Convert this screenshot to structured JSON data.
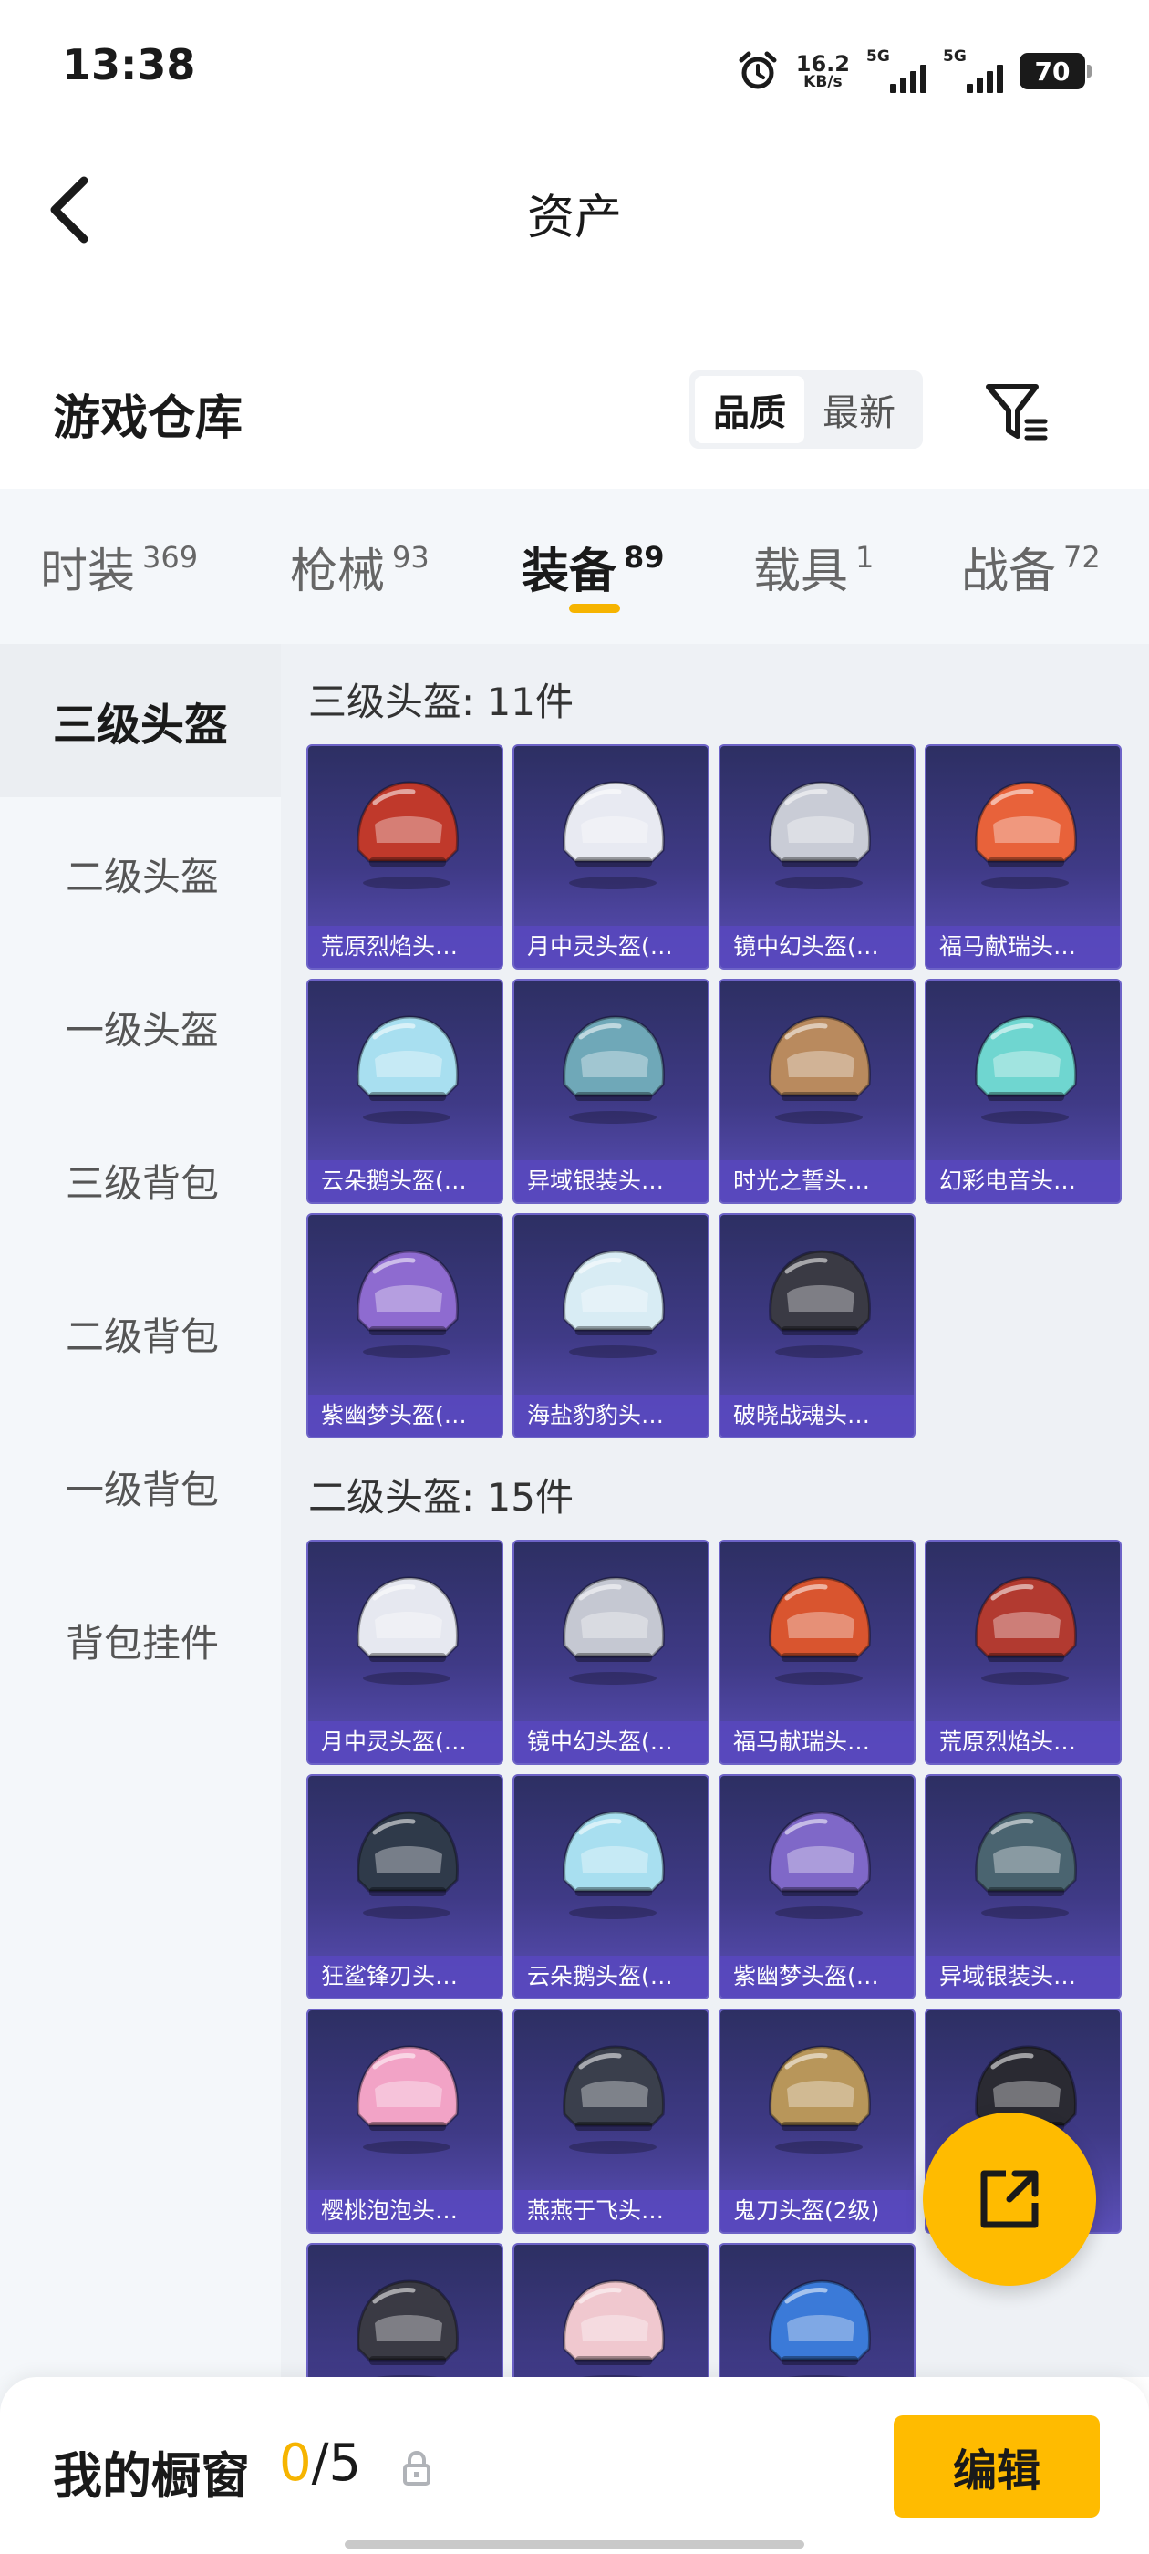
{
  "status_bar": {
    "time": "13:38",
    "speed_value": "16.2",
    "speed_unit": "KB/s",
    "sim1_label": "5G",
    "sim2_label": "5G",
    "battery": "70",
    "icons": [
      "alarm-icon",
      "signal-icon",
      "battery-icon"
    ]
  },
  "header": {
    "title": "资产",
    "back_icon": "back-arrow-icon"
  },
  "section": {
    "title": "游戏仓库",
    "sort_options": [
      "品质",
      "最新"
    ],
    "active_sort": "品质",
    "filter_icon": "filter-icon"
  },
  "tabs": [
    {
      "label": "时装",
      "count": "369",
      "active": false
    },
    {
      "label": "枪械",
      "count": "93",
      "active": false
    },
    {
      "label": "装备",
      "count": "89",
      "active": true
    },
    {
      "label": "载具",
      "count": "1",
      "active": false
    },
    {
      "label": "战备",
      "count": "72",
      "active": false
    }
  ],
  "sidebar": {
    "items": [
      {
        "label": "三级头盔",
        "active": true
      },
      {
        "label": "二级头盔",
        "active": false
      },
      {
        "label": "一级头盔",
        "active": false
      },
      {
        "label": "三级背包",
        "active": false
      },
      {
        "label": "二级背包",
        "active": false
      },
      {
        "label": "一级背包",
        "active": false
      },
      {
        "label": "背包挂件",
        "active": false
      }
    ]
  },
  "groups": [
    {
      "title": "三级头盔: 11件",
      "items": [
        {
          "name": "荒原烈焰头…",
          "color": "#c0392b"
        },
        {
          "name": "月中灵头盔(…",
          "color": "#e8eaf2"
        },
        {
          "name": "镜中幻头盔(…",
          "color": "#c9ccd6"
        },
        {
          "name": "福马献瑞头…",
          "color": "#e8623a"
        },
        {
          "name": "云朵鹅头盔(…",
          "color": "#a8dff0"
        },
        {
          "name": "异域银装头…",
          "color": "#6fa8b8"
        },
        {
          "name": "时光之誓头…",
          "color": "#b98a5e"
        },
        {
          "name": "幻彩电音头…",
          "color": "#6fd6d0"
        },
        {
          "name": "紫幽梦头盔(…",
          "color": "#8e6bd0"
        },
        {
          "name": "海盐豹豹头…",
          "color": "#d8ecf4"
        },
        {
          "name": "破晓战魂头…",
          "color": "#3a3a44"
        }
      ]
    },
    {
      "title": "二级头盔: 15件",
      "items": [
        {
          "name": "月中灵头盔(…",
          "color": "#e6e8f0"
        },
        {
          "name": "镜中幻头盔(…",
          "color": "#c5c8d2"
        },
        {
          "name": "福马献瑞头…",
          "color": "#d9552f"
        },
        {
          "name": "荒原烈焰头…",
          "color": "#b23a30"
        },
        {
          "name": "狂鲨锋刃头…",
          "color": "#2f3a4a"
        },
        {
          "name": "云朵鹅头盔(…",
          "color": "#a8dff0"
        },
        {
          "name": "紫幽梦头盔(…",
          "color": "#7f68c8"
        },
        {
          "name": "异域银装头…",
          "color": "#4a6470"
        },
        {
          "name": "樱桃泡泡头…",
          "color": "#f2a3c6"
        },
        {
          "name": "燕燕于飞头…",
          "color": "#3a3f4c"
        },
        {
          "name": "鬼刀头盔(2级)",
          "color": "#b8965a"
        },
        {
          "name": "",
          "color": "#2a2a32"
        },
        {
          "name": "",
          "color": "#3a3a44"
        },
        {
          "name": "",
          "color": "#f0c8cf"
        },
        {
          "name": "",
          "color": "#3b7ad8"
        }
      ]
    }
  ],
  "fab": {
    "icon": "share-icon"
  },
  "bottom": {
    "showcase_label": "我的橱窗",
    "showcase_current": "0",
    "showcase_total": "/5",
    "lock_icon": "lock-icon",
    "edit_label": "编辑"
  }
}
